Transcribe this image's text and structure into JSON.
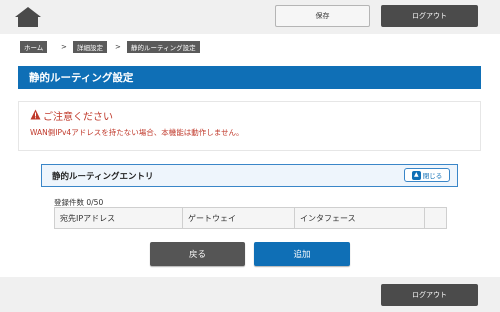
{
  "header": {
    "save_label": "保存",
    "logout_label": "ログアウト"
  },
  "breadcrumb": [
    {
      "label": "ホーム"
    },
    {
      "label": "詳細設定"
    },
    {
      "label": "静的ルーティング設定"
    }
  ],
  "breadcrumb_separator": ">",
  "page_title": "静的ルーティング設定",
  "warning": {
    "title": "ご注意ください",
    "message": "WAN側IPv4アドレスを持たない場合、本機能は動作しません。"
  },
  "entry": {
    "title": "静的ルーティングエントリ",
    "close_label": "閉じる",
    "count_text": "登録件数 0/50",
    "columns": [
      "宛先IPアドレス",
      "ゲートウェイ",
      "インタフェース",
      ""
    ]
  },
  "actions": {
    "back_label": "戻る",
    "add_label": "追加"
  },
  "footer": {
    "logout_label": "ログアウト"
  },
  "colors": {
    "accent": "#0f6fb6",
    "warning": "#c0392b",
    "dark_button": "#4b4b4b"
  },
  "icons": {
    "home": "home-icon",
    "warning": "warning-triangle-icon",
    "collapse": "chevron-up-icon"
  }
}
